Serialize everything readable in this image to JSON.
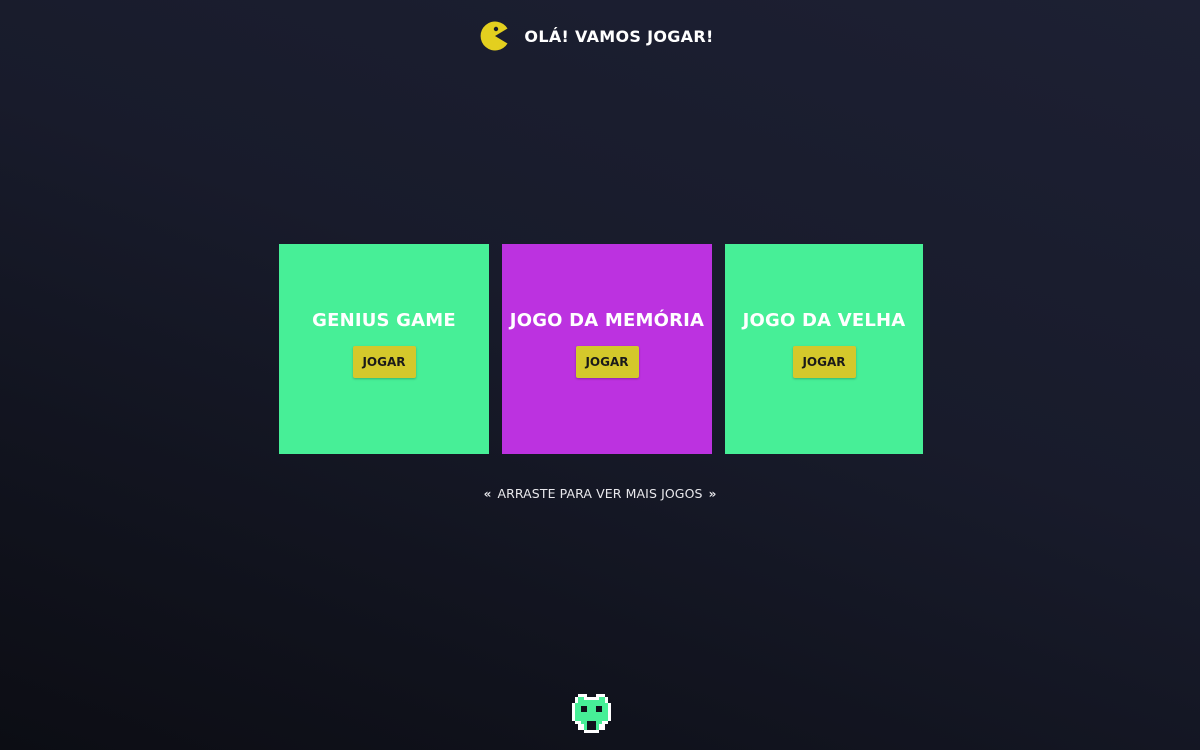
{
  "header": {
    "logo_icon": "pacman-icon",
    "title": "OLÁ! VAMOS JOGAR!"
  },
  "colors": {
    "background": "#181b2b",
    "card_green": "#47ef97",
    "card_purple": "#bc32e0",
    "button_yellow": "#d4c82b",
    "pacman_yellow": "#e3cf1f",
    "invader_green": "#47ef97"
  },
  "games": [
    {
      "title": "GENIUS GAME",
      "button_label": "JOGAR",
      "color": "#47ef97"
    },
    {
      "title": "JOGO DA MEMÓRIA",
      "button_label": "JOGAR",
      "color": "#bc32e0"
    },
    {
      "title": "JOGO DA VELHA",
      "button_label": "JOGAR",
      "color": "#47ef97"
    }
  ],
  "swipe_hint": {
    "left_arrow": "«",
    "text": "ARRASTE PARA VER MAIS JOGOS",
    "right_arrow": "»"
  },
  "footer": {
    "icon": "space-invader-icon"
  }
}
